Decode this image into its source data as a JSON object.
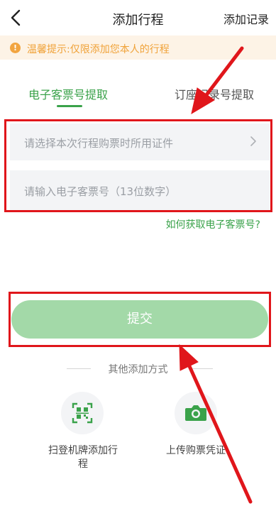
{
  "header": {
    "title": "添加行程",
    "right_action": "添加记录"
  },
  "notice": {
    "icon": "!",
    "text": "温馨提示:仅限添加您本人的行程"
  },
  "tabs": [
    {
      "label": "电子客票号提取",
      "active": true
    },
    {
      "label": "订座记录号提取",
      "active": false
    }
  ],
  "form": {
    "id_select_placeholder": "请选择本次行程购票时所用证件",
    "ticket_input_placeholder": "请输入电子客票号（13位数字）",
    "help_link": "如何获取电子客票号?"
  },
  "submit_label": "提交",
  "other_methods": {
    "title": "其他添加方式",
    "options": [
      {
        "label": "扫登机牌添加行程",
        "icon": "scan-icon"
      },
      {
        "label": "上传购票凭证",
        "icon": "camera-icon"
      }
    ]
  },
  "colors": {
    "accent": "#3aa24a",
    "notice_bg": "#fdf3e6",
    "notice_text": "#f0a238",
    "submit_bg": "#a3d9a8",
    "annotation_red": "#e0161b"
  }
}
